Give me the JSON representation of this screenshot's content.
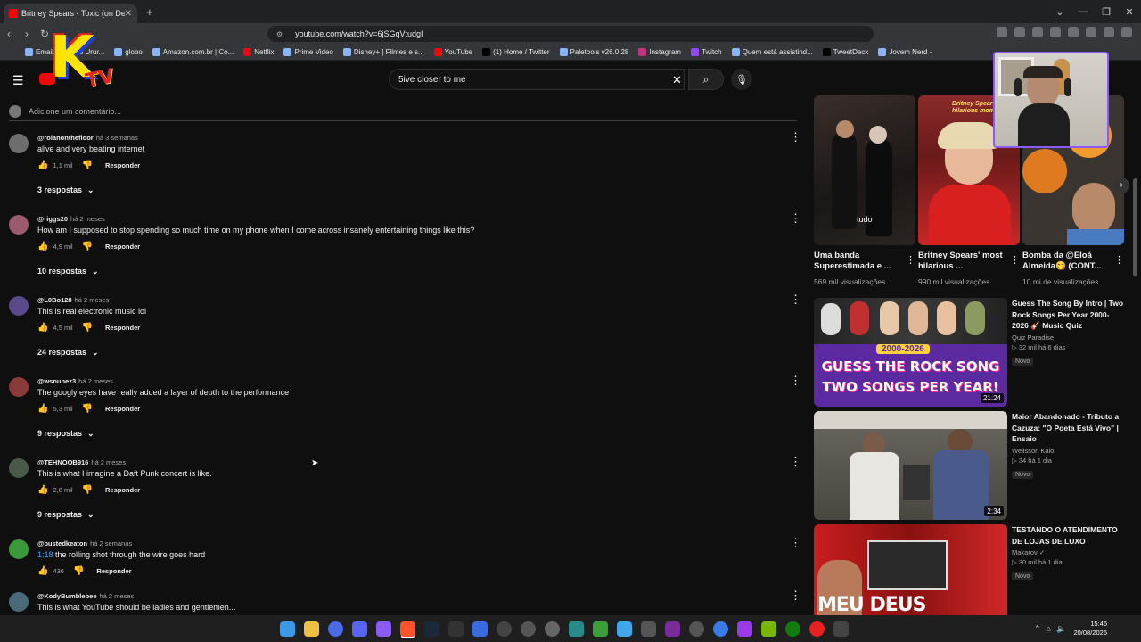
{
  "browser": {
    "tab_title": "Britney Spears - Toxic (on De...",
    "url": "youtube.com/watch?v=6jSGqVtudgI",
    "bookmarks": [
      "Email – Thiago Urur...",
      "globo",
      "Amazon.com.br | Co...",
      "Netflix",
      "Prime Video",
      "Disney+ | Filmes e s...",
      "YouTube",
      "(1) Home / Twitter",
      "Paletools v26.0.28",
      "Instagram",
      "Twitch",
      "Quem está assistind...",
      "TweetDeck",
      "Jovem Nerd -"
    ]
  },
  "youtube": {
    "search_value": "5ive closer to me"
  },
  "comments_section": {
    "add_placeholder": "Adicione um comentário...",
    "reply_label": "Responder",
    "comments": [
      {
        "user": "@rolanonthefloor",
        "time": "há 3 semanas",
        "text": "alive and very beating internet",
        "likes": "1,1 mil",
        "replies": "3 respostas",
        "avatar_color": "#6e6e6e"
      },
      {
        "user": "@riggs20",
        "time": "há 2 meses",
        "text": "How am I supposed to stop spending so much time on my phone when I come across insanely entertaining things like this?",
        "likes": "4,9 mil",
        "replies": "10 respostas",
        "avatar_color": "#9c5a6e"
      },
      {
        "user": "@L0Bo128",
        "time": "há 2 meses",
        "text": "This is real electronic music lol",
        "likes": "4,5 mil",
        "replies": "24 respostas",
        "avatar_color": "#5a4a8a"
      },
      {
        "user": "@wsnunez3",
        "time": "há 2 meses",
        "text": "The googly eyes have really added a layer of depth to the performance",
        "likes": "5,3 mil",
        "replies": "9 respostas",
        "avatar_color": "#8a3a3a"
      },
      {
        "user": "@TEHNOOB916",
        "time": "há 2 meses",
        "text": "This is what I imagine a Daft Punk concert is like.",
        "likes": "2,8 mil",
        "replies": "9 respostas",
        "avatar_color": "#4a5a4a"
      },
      {
        "user": "@bustedkeaton",
        "time": "há 2 semanas",
        "timestamp": "1:18",
        "text": " the rolling shot through the wire goes hard",
        "likes": "436",
        "replies": "",
        "avatar_color": "#3a9a3a"
      },
      {
        "user": "@KodyBumblebee",
        "time": "há 2 meses",
        "text": "This is what YouTube should be ladies and gentlemen...",
        "likes": "",
        "replies": "",
        "avatar_color": "#4a6a7a"
      }
    ]
  },
  "shorts": [
    {
      "title": "Uma banda Superestimada e ...",
      "views": "569 mil visualizações",
      "overlay": "tudo"
    },
    {
      "title": "Britney Spears' most hilarious ...",
      "views": "990 mil visualizações",
      "overlay": "Britney Spears' most hilarious mom"
    },
    {
      "title": "Bomba da @Eloá Almeida😋 (CONT...",
      "views": "10 mi de visualizações",
      "overlay": ""
    }
  ],
  "recommended": [
    {
      "title": "Guess The Song By Intro | Two Rock Songs Per Year 2000-2026 🎸 Music Quiz",
      "channel": "Quiz Paradise",
      "meta": "▷ 32 mil  há 6 dias",
      "badge": "Novo",
      "duration": "21:24",
      "thumb_text": "GUESS THE ROCK SONG TWO SONGS PER YEAR!",
      "thumb_year": "2000-2026"
    },
    {
      "title": "Maior Abandonado - Tributo a Cazuza: \"O Poeta Está Vivo\" | Ensaio",
      "channel": "Welisson Kaio",
      "meta": "▷ 34  há 1 dia",
      "badge": "Novo",
      "duration": "2:34"
    },
    {
      "title": "TESTANDO O ATENDIMENTO DE LOJAS DE LUXO",
      "channel": "Makarov ✓",
      "meta": "▷ 30 mil  há 1 dia",
      "badge": "Novo",
      "duration": "",
      "thumb_text": "MEU DEUS"
    }
  ],
  "taskbar": {
    "time": "15:46",
    "date": "20/08/2026"
  },
  "overlay_logo": {
    "letters": "K",
    "suffix": "TV"
  },
  "colors": {
    "accent": "#ff0000",
    "link": "#3ea6ff",
    "taskbar_bg": "#1f1f1f"
  }
}
